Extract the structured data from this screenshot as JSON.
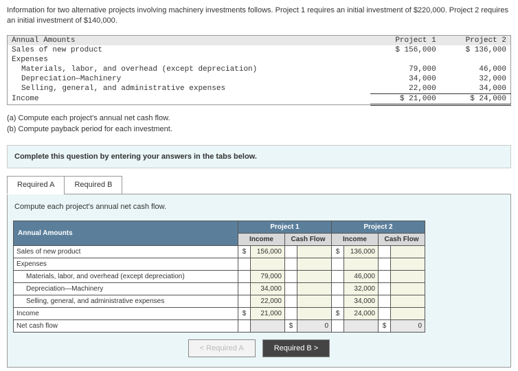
{
  "intro": "Information for two alternative projects involving machinery investments follows. Project 1 requires an initial investment of $220,000. Project 2 requires an initial investment of $140,000.",
  "amounts": {
    "header": {
      "c0": "Annual Amounts",
      "c1": "Project 1",
      "c2": "Project 2"
    },
    "rows": [
      {
        "label": "Sales of new product",
        "p1": "$ 156,000",
        "p2": "$ 136,000"
      },
      {
        "label": "Expenses",
        "p1": "",
        "p2": ""
      },
      {
        "label": "Materials, labor, and overhead (except depreciation)",
        "indent": true,
        "p1": "79,000",
        "p2": "46,000"
      },
      {
        "label": "Depreciation—Machinery",
        "indent": true,
        "p1": "34,000",
        "p2": "32,000"
      },
      {
        "label": "Selling, general, and administrative expenses",
        "indent": true,
        "p1": "22,000",
        "p2": "34,000",
        "under": true
      },
      {
        "label": "Income",
        "p1": "$ 21,000",
        "p2": "$ 24,000",
        "dbl": true
      }
    ]
  },
  "questions": {
    "a": "(a) Compute each project's annual net cash flow.",
    "b": "(b) Compute payback period for each investment."
  },
  "instruct": "Complete this question by entering your answers in the tabs below.",
  "tabs": {
    "a": "Required A",
    "b": "Required B"
  },
  "panel_sub": "Compute each project's annual net cash flow.",
  "calc": {
    "aa": "Annual Amounts",
    "p1": "Project 1",
    "p2": "Project 2",
    "inc": "Income",
    "cf": "Cash Flow",
    "rows": [
      {
        "label": "Sales of new product",
        "m1": "$",
        "v1": "156,000",
        "cf1": "",
        "m2": "$",
        "v2": "136,000",
        "cf2": ""
      },
      {
        "label": "Expenses",
        "v1": "",
        "cf1": "",
        "v2": "",
        "cf2": ""
      },
      {
        "label": "Materials, labor, and overhead (except depreciation)",
        "ind": true,
        "v1": "79,000",
        "cf1": "",
        "v2": "46,000",
        "cf2": ""
      },
      {
        "label": "Depreciation—Machinery",
        "ind": true,
        "v1": "34,000",
        "cf1": "",
        "v2": "32,000",
        "cf2": ""
      },
      {
        "label": "Selling, general, and administrative expenses",
        "ind": true,
        "v1": "22,000",
        "cf1": "",
        "v2": "34,000",
        "cf2": ""
      },
      {
        "label": "Income",
        "m1": "$",
        "v1": "21,000",
        "cf1": "",
        "m2": "$",
        "v2": "24,000",
        "cf2": ""
      },
      {
        "label": "Net cash flow",
        "v1": "",
        "cfm1": "$",
        "cf1": "0",
        "v2": "",
        "cfm2": "$",
        "cf2": "0",
        "ro": true
      }
    ]
  },
  "nav": {
    "prev": "<  Required A",
    "next": "Required B  >"
  }
}
